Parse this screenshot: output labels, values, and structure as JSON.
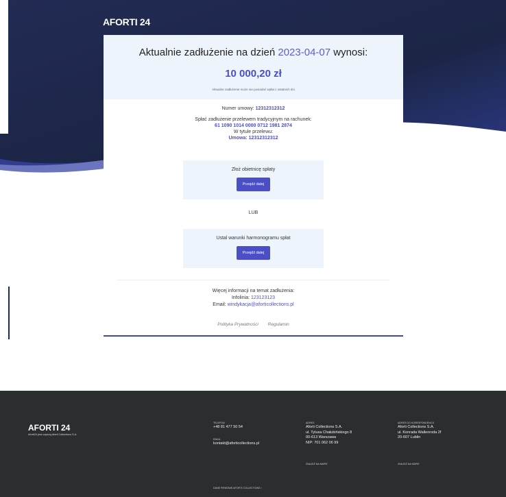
{
  "brand": {
    "name_a": "AFORTI",
    "name_b": "24"
  },
  "summary": {
    "title_prefix": "Aktualnie zadłużenie na dzień ",
    "date": "2023-04-07",
    "title_suffix": " wynosi:",
    "amount": "10 000,20 zł",
    "note": "Aktualne zadłużenie może nie posiadać wpłat z ostatnich dni"
  },
  "details": {
    "contract_label": "Numer umowy: ",
    "contract_number": "12312312312",
    "pay_label": "Spłać zadłużenie przelewem tradycyjnym na rachunek:",
    "account": "61 1090 1014 0000 0712 1981 2874",
    "title_label": "W tytule przelewu:",
    "title_value": "Umowa: 12312312312"
  },
  "option1": {
    "label": "Złoż obietnicę spłaty",
    "button": "Przejdź dalej"
  },
  "or_text": "LUB",
  "option2": {
    "label": "Ustal warunki harmonogramu spłat",
    "button": "Przejdź dalej"
  },
  "more": {
    "heading": "Więcej informacji na temat zadłużenia:",
    "phone_label": "Infolinia: ",
    "phone": "123123123",
    "email_label": "Email: ",
    "email": "windykacja@aforticollections.pl"
  },
  "links": {
    "privacy": "Polityka Prywatności",
    "terms": "Regulamin"
  },
  "footer": {
    "brand": "AFORTI 24",
    "sub": "Aforti24 jest częścią Aforti Collections S.A.",
    "phone_label": "TELEFON",
    "phone": "+48 81 477 50 54",
    "email_label": "EMAIL",
    "email": "kontakt@aforticollections.pl",
    "company_link": "DANE FIRMOWE AFORTI COLLECTIONS   ›",
    "address_label": "ADRES",
    "address_1": "Aforti Collections S.A.",
    "address_2": "ul. Tytusa Chałubińskiego 8",
    "address_3": "00-613 Warszawa",
    "address_4": "NIP: 701 062 06 99",
    "map1": "ZNAJDŹ NA MAPIE",
    "corr_label": "ADRES DO KORESPONDENCJI",
    "corr_1": "Aforti Collections S.A.",
    "corr_2": "ul. Konrada Wallenroda 2f",
    "corr_3": "20-607 Lublin",
    "map2": "ZNAJDŹ NA MAPIE"
  },
  "colors": {
    "hero_dark": "#1e2a4f",
    "accent": "#4a4fc8",
    "panel": "#eef4fc",
    "footer": "#2b2e2e"
  }
}
